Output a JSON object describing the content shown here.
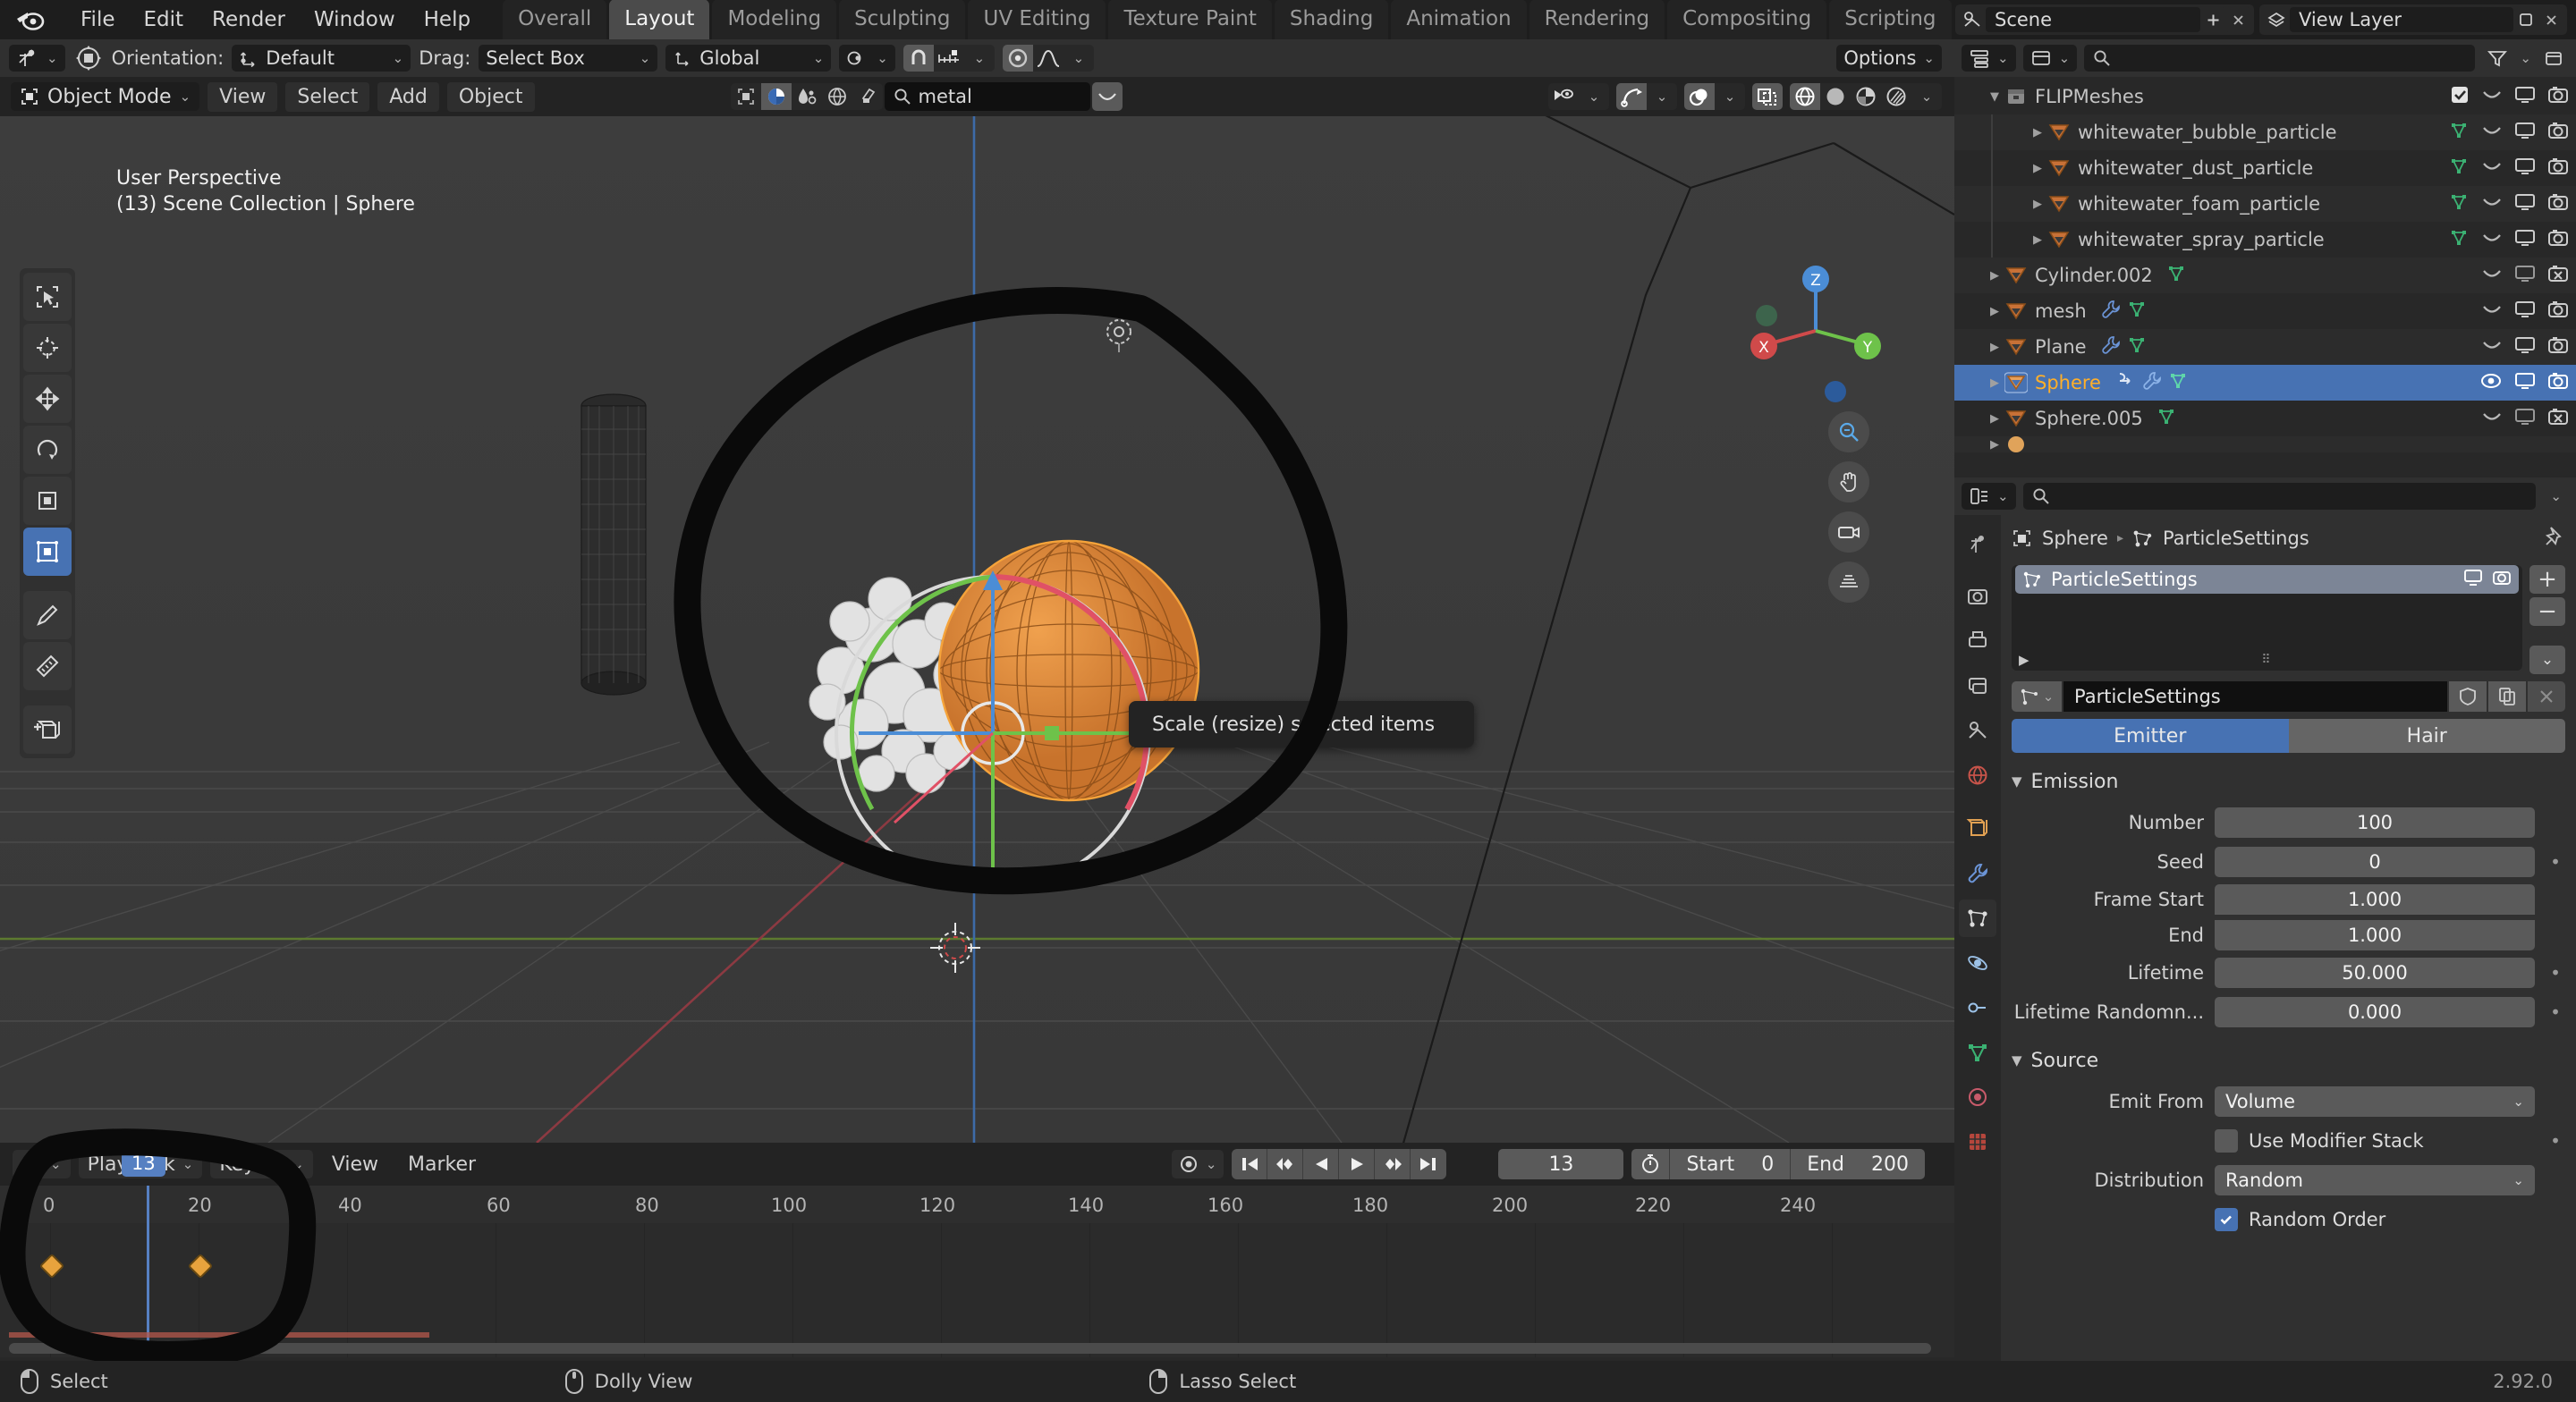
{
  "topbar": {
    "menus": [
      "File",
      "Edit",
      "Render",
      "Window",
      "Help"
    ],
    "workspace_tabs": [
      {
        "label": "Overall",
        "active": false
      },
      {
        "label": "Layout",
        "active": true
      },
      {
        "label": "Modeling",
        "active": false
      },
      {
        "label": "Sculpting",
        "active": false
      },
      {
        "label": "UV Editing",
        "active": false
      },
      {
        "label": "Texture Paint",
        "active": false
      },
      {
        "label": "Shading",
        "active": false
      },
      {
        "label": "Animation",
        "active": false
      },
      {
        "label": "Rendering",
        "active": false
      },
      {
        "label": "Compositing",
        "active": false
      },
      {
        "label": "Scripting",
        "active": false
      }
    ],
    "scene_name": "Scene",
    "view_layer_name": "View Layer"
  },
  "tool_settings": {
    "orientation_label": "Orientation:",
    "orientation_value": "Default",
    "drag_label": "Drag:",
    "drag_value": "Select Box",
    "transform_space": "Global"
  },
  "viewport_header": {
    "mode": "Object Mode",
    "menus": [
      "View",
      "Select",
      "Add",
      "Object"
    ],
    "search_value": "metal"
  },
  "viewport": {
    "perspective_line": "User Perspective",
    "scene_line": "(13) Scene Collection | Sphere",
    "tooltip": "Scale (resize) selected items",
    "gizmo_axes": [
      "Z",
      "X",
      "Y"
    ]
  },
  "outliner": {
    "rows": [
      {
        "label": "FLIPMeshes",
        "depth": 0,
        "type": "collection",
        "expanded": true,
        "selected": false,
        "checkbox": true,
        "modifier": false,
        "anim": false,
        "mesh_data": false,
        "eye": false,
        "render_x": false
      },
      {
        "label": "whitewater_bubble_particle",
        "depth": 2,
        "type": "mesh",
        "expanded": false,
        "selected": false,
        "checkbox": false,
        "modifier": false,
        "anim": false,
        "mesh_data": true,
        "eye": false,
        "render_x": false
      },
      {
        "label": "whitewater_dust_particle",
        "depth": 2,
        "type": "mesh",
        "expanded": false,
        "selected": false,
        "checkbox": false,
        "modifier": false,
        "anim": false,
        "mesh_data": true,
        "eye": false,
        "render_x": false
      },
      {
        "label": "whitewater_foam_particle",
        "depth": 2,
        "type": "mesh",
        "expanded": false,
        "selected": false,
        "checkbox": false,
        "modifier": false,
        "anim": false,
        "mesh_data": true,
        "eye": false,
        "render_x": false
      },
      {
        "label": "whitewater_spray_particle",
        "depth": 2,
        "type": "mesh",
        "expanded": false,
        "selected": false,
        "checkbox": false,
        "modifier": false,
        "anim": false,
        "mesh_data": true,
        "eye": false,
        "render_x": false
      },
      {
        "label": "Cylinder.002",
        "depth": 1,
        "type": "mesh",
        "expanded": false,
        "selected": false,
        "checkbox": false,
        "modifier": false,
        "anim": false,
        "mesh_data": true,
        "eye": false,
        "render_x": true
      },
      {
        "label": "mesh",
        "depth": 1,
        "type": "mesh",
        "expanded": false,
        "selected": false,
        "checkbox": false,
        "modifier": true,
        "anim": false,
        "mesh_data": true,
        "eye": false,
        "render_x": false
      },
      {
        "label": "Plane",
        "depth": 1,
        "type": "mesh",
        "expanded": false,
        "selected": false,
        "checkbox": false,
        "modifier": true,
        "anim": false,
        "mesh_data": true,
        "eye": false,
        "render_x": false
      },
      {
        "label": "Sphere",
        "depth": 1,
        "type": "mesh",
        "expanded": false,
        "selected": true,
        "checkbox": false,
        "modifier": true,
        "anim": true,
        "mesh_data": true,
        "eye": true,
        "render_x": false
      },
      {
        "label": "Sphere.005",
        "depth": 1,
        "type": "mesh",
        "expanded": false,
        "selected": false,
        "checkbox": false,
        "modifier": false,
        "anim": false,
        "mesh_data": true,
        "eye": false,
        "render_x": true
      }
    ]
  },
  "properties": {
    "breadcrumb_object": "Sphere",
    "breadcrumb_data": "ParticleSettings",
    "list_item": "ParticleSettings",
    "datablock_name": "ParticleSettings",
    "type_toggle": [
      {
        "label": "Emitter",
        "active": true
      },
      {
        "label": "Hair",
        "active": false
      }
    ],
    "emission": {
      "title": "Emission",
      "fields": [
        {
          "label": "Number",
          "value": "100",
          "animatable": false
        },
        {
          "label": "Seed",
          "value": "0",
          "animatable": true
        },
        {
          "label": "Frame Start",
          "value": "1.000",
          "animatable": false
        },
        {
          "label": "End",
          "value": "1.000",
          "animatable": false
        },
        {
          "label": "Lifetime",
          "value": "50.000",
          "animatable": true
        },
        {
          "label": "Lifetime Randomn...",
          "value": "0.000",
          "animatable": true
        }
      ]
    },
    "source": {
      "title": "Source",
      "emit_from_label": "Emit From",
      "emit_from_value": "Volume",
      "use_modifier_stack_label": "Use Modifier Stack",
      "use_modifier_stack_checked": false,
      "distribution_label": "Distribution",
      "distribution_value": "Random",
      "random_order_label": "Random Order",
      "random_order_checked": true
    }
  },
  "timeline": {
    "playback_label": "Playback",
    "keying_label": "Keying",
    "menus": [
      "View",
      "Marker"
    ],
    "current_frame": "13",
    "start_label": "Start",
    "start_value": "0",
    "end_label": "End",
    "end_value": "200",
    "ruler_ticks": [
      "0",
      "20",
      "40",
      "60",
      "80",
      "100",
      "120",
      "140",
      "160",
      "180",
      "200",
      "220",
      "240"
    ],
    "keyframes": [
      0,
      20
    ]
  },
  "statusbar": {
    "items": [
      {
        "label": "Select",
        "icon": "mouse-left-icon"
      },
      {
        "label": "Dolly View",
        "icon": "mouse-middle-icon"
      },
      {
        "label": "Lasso Select",
        "icon": "mouse-right-icon"
      }
    ],
    "version": "2.92.0"
  },
  "colors": {
    "accent_blue": "#4772b3",
    "selected_text": "#ffaf29",
    "keyframe_orange": "#e8a33d",
    "mesh_icon_orange": "#c87137",
    "data_green": "#3bb273"
  }
}
